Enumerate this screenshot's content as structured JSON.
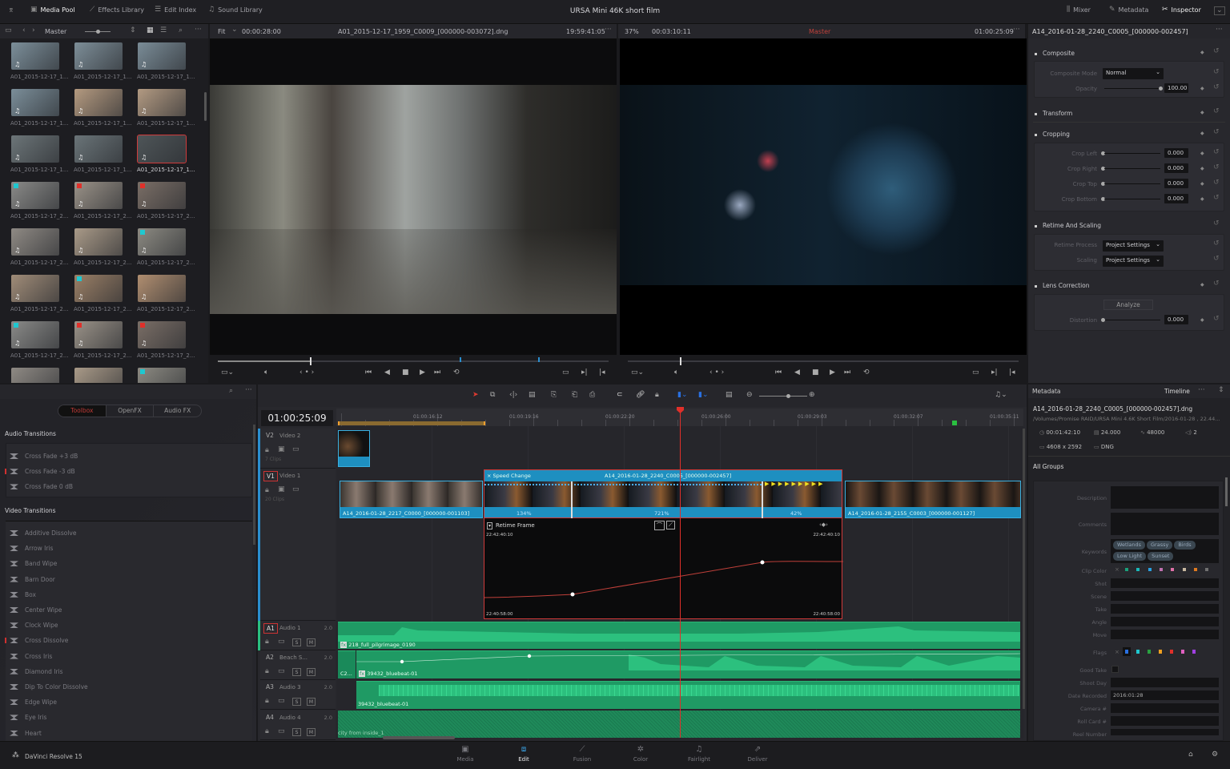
{
  "app": {
    "title": "URSA Mini 46K short film",
    "brand": "DaVinci Resolve 15"
  },
  "top_left_tabs": [
    {
      "label": "Media Pool",
      "icon": "media-pool-icon",
      "active": true
    },
    {
      "label": "Effects Library",
      "icon": "effects-wand-icon",
      "active": false
    },
    {
      "label": "Edit Index",
      "icon": "list-icon",
      "active": false
    },
    {
      "label": "Sound Library",
      "icon": "music-list-icon",
      "active": false
    }
  ],
  "top_right_tabs": [
    {
      "label": "Mixer",
      "icon": "mixer-icon",
      "active": false
    },
    {
      "label": "Metadata",
      "icon": "metadata-icon",
      "active": false
    },
    {
      "label": "Inspector",
      "icon": "inspector-icon",
      "active": true
    }
  ],
  "media_pool": {
    "bin": "Master",
    "clips": [
      {
        "name": "A01_2015-12-17_1...",
        "tone": "#7c8f9a",
        "flag": ""
      },
      {
        "name": "A01_2015-12-17_1...",
        "tone": "#7d8e98",
        "flag": ""
      },
      {
        "name": "A01_2015-12-17_1...",
        "tone": "#7a8c97",
        "flag": ""
      },
      {
        "name": "A01_2015-12-17_1...",
        "tone": "#7b8e99",
        "flag": ""
      },
      {
        "name": "A01_2015-12-17_1...",
        "tone": "#b49a80",
        "flag": ""
      },
      {
        "name": "A01_2015-12-17_1...",
        "tone": "#b29a82",
        "flag": ""
      },
      {
        "name": "A01_2015-12-17_1...",
        "tone": "#6c7578",
        "flag": ""
      },
      {
        "name": "A01_2015-12-17_1...",
        "tone": "#6a7478",
        "flag": ""
      },
      {
        "name": "A01_2015-12-17_1...",
        "tone": "#4e5558",
        "flag": "",
        "selected": true
      },
      {
        "name": "A01_2015-12-17_2...",
        "tone": "#8a8a88",
        "flag": "#1fc8d0"
      },
      {
        "name": "A01_2015-12-17_2...",
        "tone": "#9a9288",
        "flag": "#e0302a"
      },
      {
        "name": "A01_2015-12-17_2...",
        "tone": "#7a6e66",
        "flag": "#e0302a"
      },
      {
        "name": "A01_2015-12-17_2...",
        "tone": "#8f8a84",
        "flag": ""
      },
      {
        "name": "A01_2015-12-17_2...",
        "tone": "#a99a88",
        "flag": ""
      },
      {
        "name": "A01_2015-12-17_2...",
        "tone": "#8c8a82",
        "flag": "#1fc8d0"
      },
      {
        "name": "A01_2015-12-17_2...",
        "tone": "#a08c78",
        "flag": ""
      },
      {
        "name": "A01_2015-12-17_2...",
        "tone": "#9a7f66",
        "flag": "#1fc8d0"
      },
      {
        "name": "A01_2015-12-17_2...",
        "tone": "#b08e70",
        "flag": ""
      },
      {
        "name": "A01_2015-12-17_2...",
        "tone": "#8a8a88",
        "flag": "#1fc8d0"
      },
      {
        "name": "A01_2015-12-17_2...",
        "tone": "#9a9288",
        "flag": "#e0302a"
      },
      {
        "name": "A01_2015-12-17_2...",
        "tone": "#7a6e66",
        "flag": "#e0302a"
      },
      {
        "name": "",
        "tone": "#8f8a84",
        "flag": ""
      },
      {
        "name": "",
        "tone": "#a99a88",
        "flag": ""
      },
      {
        "name": "",
        "tone": "#8c8a82",
        "flag": "#1fc8d0"
      }
    ]
  },
  "source_viewer": {
    "zoom": "Fit",
    "duration": "00:00:28:00",
    "clip": "A01_2015-12-17_1959_C0009_[000000-003072].dng",
    "timecode": "19:59:41:05"
  },
  "timeline_viewer": {
    "zoom": "37%",
    "duration": "00:03:10:11",
    "timeline": "Master",
    "timecode": "01:00:25:09"
  },
  "inspector": {
    "clip": "A14_2016-01-28_2240_C0005_[000000-002457]",
    "composite": {
      "title": "Composite",
      "mode_label": "Composite Mode",
      "mode": "Normal",
      "opacity_label": "Opacity",
      "opacity": "100.00",
      "opacity_level": 1.0
    },
    "transform": {
      "title": "Transform"
    },
    "cropping": {
      "title": "Cropping",
      "rows": [
        {
          "label": "Crop Left",
          "value": "0.000"
        },
        {
          "label": "Crop Right",
          "value": "0.000"
        },
        {
          "label": "Crop Top",
          "value": "0.000"
        },
        {
          "label": "Crop Bottom",
          "value": "0.000"
        }
      ]
    },
    "retime": {
      "title": "Retime And Scaling",
      "process_label": "Retime Process",
      "process": "Project Settings",
      "scaling_label": "Scaling",
      "scaling": "Project Settings"
    },
    "lens": {
      "title": "Lens Correction",
      "analyze": "Analyze",
      "distortion_label": "Distortion",
      "distortion": "0.000"
    }
  },
  "effects": {
    "tabs": [
      {
        "label": "Toolbox",
        "active": true
      },
      {
        "label": "OpenFX",
        "active": false
      },
      {
        "label": "Audio FX",
        "active": false
      }
    ],
    "audio_title": "Audio Transitions",
    "audio": [
      {
        "label": "Cross Fade +3 dB"
      },
      {
        "label": "Cross Fade -3 dB",
        "marked": true
      },
      {
        "label": "Cross Fade 0 dB"
      }
    ],
    "video_title": "Video Transitions",
    "video": [
      {
        "label": "Additive Dissolve"
      },
      {
        "label": "Arrow Iris"
      },
      {
        "label": "Band Wipe"
      },
      {
        "label": "Barn Door"
      },
      {
        "label": "Box"
      },
      {
        "label": "Center Wipe"
      },
      {
        "label": "Clock Wipe"
      },
      {
        "label": "Cross Dissolve",
        "marked": true
      },
      {
        "label": "Cross Iris"
      },
      {
        "label": "Diamond Iris"
      },
      {
        "label": "Dip To Color Dissolve"
      },
      {
        "label": "Edge Wipe"
      },
      {
        "label": "Eye Iris"
      },
      {
        "label": "Heart"
      }
    ]
  },
  "timeline": {
    "timecode": "01:00:25:09",
    "ruler": [
      "01:00:16:12",
      "01:00:19:16",
      "01:00:22:20",
      "01:00:26:00",
      "01:00:29:03",
      "01:00:32:07",
      "01:00:35:11"
    ],
    "tracks": {
      "v2": {
        "id": "V2",
        "name": "Video 2",
        "clips": "7 Clips"
      },
      "v1": {
        "id": "V1",
        "name": "Video 1",
        "clips": "20 Clips"
      },
      "a1": {
        "id": "A1",
        "name": "Audio 1",
        "ch": "2.0"
      },
      "a2": {
        "id": "A2",
        "name": "Beach S...",
        "ch": "2.0"
      },
      "a3": {
        "id": "A3",
        "name": "Audio 3",
        "ch": "2.0"
      },
      "a4": {
        "id": "A4",
        "name": "Audio 4",
        "ch": "2.0"
      }
    },
    "solo": "S",
    "mute": "M",
    "v1_clip_a": "A14_2016-01-28_2217_C0000_[000000-001103]",
    "v1_clip_b": "A14_2016-01-28_2155_C0003_[000000-001127]",
    "speed_clip": {
      "title": "Speed Change",
      "name": "A14_2016-01-28_2240_C0005_[000000-002457]",
      "speeds": [
        "134%",
        "721%",
        "42%"
      ]
    },
    "retime_frame": {
      "title": "Retime Frame",
      "top_left": "22:42:40:10",
      "top_right": "22:42:40:10",
      "bottom_left": "22:40:58:00",
      "bottom_right": "22:40:58:00"
    },
    "audio_clips": {
      "a1": "218_full_pilgrimage_0190",
      "a2_left": "C2...",
      "a2": "39432_bluebeat-01",
      "a3": "39432_bluebeat-01",
      "a4": "city from inside_1"
    },
    "colors": {
      "video_clip": "#1e8fc0",
      "audio_clip": "#1f9a64",
      "playhead": "#e0302a",
      "selection": "#d03a3a"
    }
  },
  "metadata": {
    "title": "Metadata",
    "scope": "Timeline",
    "file": "A14_2016-01-28_2240_C0005_[000000-002457].dng",
    "path": "/Volumes/Promise RAID/URSA Mini 4.6K Short Film/2016-01-28 , 22.44...",
    "duration": "00:01:42:10",
    "fps": "24.000",
    "sample_rate": "48000",
    "channels": "2",
    "resolution": "4608 x 2592",
    "format": "DNG",
    "group": "All Groups",
    "keywords": [
      "Wetlands",
      "Grassy",
      "Birds",
      "Low Light",
      "Sunset"
    ],
    "clip_colors": [
      "#1aa07a",
      "#1ab8b8",
      "#2aa0e0",
      "#c070b0",
      "#e070a8",
      "#c8b8a0",
      "#e07a20",
      "#707070"
    ],
    "flag_colors": [
      "#2a70e0",
      "#1fc8d0",
      "#2aa040",
      "#f0a020",
      "#e0302a",
      "#e060c0",
      "#a040e0"
    ],
    "fields": {
      "description": "Description",
      "comments": "Comments",
      "keywords": "Keywords",
      "clip_color": "Clip Color",
      "shot": "Shot",
      "scene": "Scene",
      "take": "Take",
      "angle": "Angle",
      "move": "Move",
      "flags": "Flags",
      "good_take": "Good Take",
      "shoot_day": "Shoot Day",
      "date_recorded": "Date Recorded",
      "camera": "Camera #",
      "roll": "Roll Card #",
      "reel": "Reel Number"
    },
    "date_recorded_value": "2016:01:28"
  },
  "pages": [
    {
      "label": "Media",
      "icon": "media-page-icon"
    },
    {
      "label": "Edit",
      "icon": "edit-page-icon",
      "active": true
    },
    {
      "label": "Fusion",
      "icon": "fusion-page-icon"
    },
    {
      "label": "Color",
      "icon": "color-page-icon"
    },
    {
      "label": "Fairlight",
      "icon": "fairlight-page-icon"
    },
    {
      "label": "Deliver",
      "icon": "deliver-page-icon"
    }
  ]
}
